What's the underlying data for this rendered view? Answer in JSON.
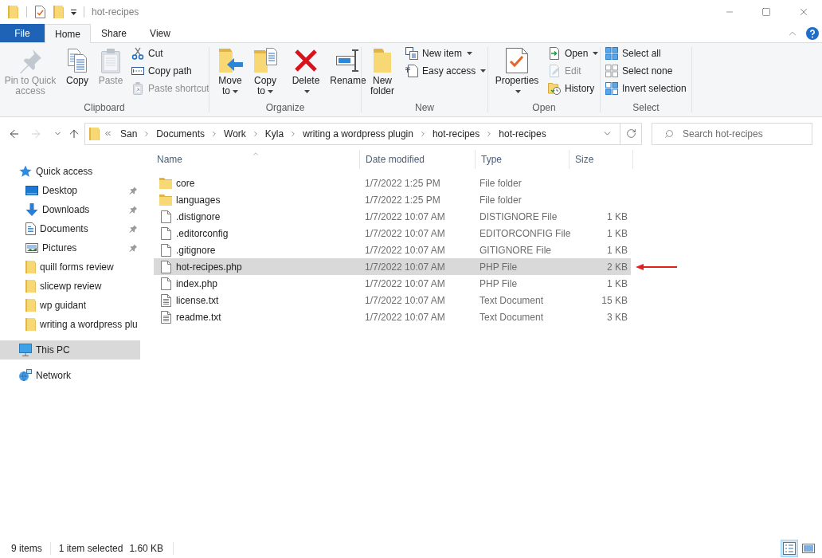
{
  "title_bar": {
    "title": "hot-recipes"
  },
  "ribbon_tabs": [
    {
      "kind": "file",
      "label": "File",
      "selected": false
    },
    {
      "kind": "tab",
      "label": "Home",
      "selected": true
    },
    {
      "kind": "tab",
      "label": "Share",
      "selected": false
    },
    {
      "kind": "tab",
      "label": "View",
      "selected": false
    }
  ],
  "ribbon_groups": [
    {
      "label": "Clipboard",
      "items": [
        {
          "kind": "large",
          "label": "Pin to Quick access",
          "disabled": true,
          "dropdown": false
        },
        {
          "kind": "large",
          "label": "Copy",
          "disabled": false,
          "dropdown": false
        },
        {
          "kind": "large",
          "label": "Paste",
          "disabled": true,
          "dropdown": false
        },
        {
          "kind": "small",
          "label": "Cut",
          "disabled": false,
          "dropdown": false
        },
        {
          "kind": "small",
          "label": "Copy path",
          "disabled": false,
          "dropdown": false
        },
        {
          "kind": "small",
          "label": "Paste shortcut",
          "disabled": true,
          "dropdown": false
        }
      ]
    },
    {
      "label": "Organize",
      "items": [
        {
          "kind": "large",
          "label": "Move to",
          "disabled": false,
          "dropdown": true
        },
        {
          "kind": "large",
          "label": "Copy to",
          "disabled": false,
          "dropdown": true
        },
        {
          "kind": "large",
          "label": "Delete",
          "disabled": false,
          "dropdown": true
        },
        {
          "kind": "large",
          "label": "Rename",
          "disabled": false,
          "dropdown": false
        }
      ]
    },
    {
      "label": "New",
      "items": [
        {
          "kind": "large",
          "label": "New folder",
          "disabled": false,
          "dropdown": false
        },
        {
          "kind": "small",
          "label": "New item",
          "disabled": false,
          "dropdown": true
        },
        {
          "kind": "small",
          "label": "Easy access",
          "disabled": false,
          "dropdown": true
        }
      ]
    },
    {
      "label": "Open",
      "items": [
        {
          "kind": "large",
          "label": "Properties",
          "disabled": false,
          "dropdown": true
        },
        {
          "kind": "small",
          "label": "Open",
          "disabled": false,
          "dropdown": true
        },
        {
          "kind": "small",
          "label": "Edit",
          "disabled": true,
          "dropdown": false
        },
        {
          "kind": "small",
          "label": "History",
          "disabled": false,
          "dropdown": false
        }
      ]
    },
    {
      "label": "Select",
      "items": [
        {
          "kind": "small",
          "label": "Select all",
          "disabled": false,
          "dropdown": false
        },
        {
          "kind": "small",
          "label": "Select none",
          "disabled": false,
          "dropdown": false
        },
        {
          "kind": "small",
          "label": "Invert selection",
          "disabled": false,
          "dropdown": false
        }
      ]
    }
  ],
  "nav_buttons": [
    {
      "kind": "back",
      "disabled": false
    },
    {
      "kind": "forward",
      "disabled": true
    },
    {
      "kind": "recent",
      "disabled": false
    },
    {
      "kind": "up",
      "disabled": false
    }
  ],
  "address_bar": {
    "path": [
      "San",
      "Documents",
      "Work",
      "Kyla",
      "writing a wordpress plugin",
      "hot-recipes",
      "hot-recipes"
    ]
  },
  "search": {
    "placeholder": "Search hot-recipes"
  },
  "navigation_pane": {
    "items": [
      {
        "kind": "quick-access",
        "label": "Quick access",
        "selected": false,
        "children": [
          {
            "kind": "desktop",
            "label": "Desktop",
            "pinned": true,
            "selected": false
          },
          {
            "kind": "downloads",
            "label": "Downloads",
            "pinned": true,
            "selected": false
          },
          {
            "kind": "documents",
            "label": "Documents",
            "pinned": true,
            "selected": false
          },
          {
            "kind": "pictures",
            "label": "Pictures",
            "pinned": true,
            "selected": false
          },
          {
            "kind": "folder",
            "label": "quill forms review",
            "pinned": false,
            "selected": false
          },
          {
            "kind": "folder",
            "label": "slicewp review",
            "pinned": false,
            "selected": false
          },
          {
            "kind": "folder",
            "label": "wp guidant",
            "pinned": false,
            "selected": false
          },
          {
            "kind": "folder",
            "label": "writing a wordpress plu",
            "pinned": false,
            "selected": false
          }
        ]
      },
      {
        "kind": "pc",
        "label": "This PC",
        "selected": true
      },
      {
        "kind": "network",
        "label": "Network",
        "selected": false
      }
    ]
  },
  "file_list": {
    "columns": [
      {
        "label": "Name",
        "sorted": true
      },
      {
        "label": "Date modified",
        "sorted": false
      },
      {
        "label": "Type",
        "sorted": false
      },
      {
        "label": "Size",
        "sorted": false
      }
    ],
    "rows": [
      {
        "kind": "folder",
        "name": "core",
        "date": "1/7/2022 1:25 PM",
        "type": "File folder",
        "selected": false,
        "marked": false
      },
      {
        "kind": "folder",
        "name": "languages",
        "date": "1/7/2022 1:25 PM",
        "type": "File folder",
        "selected": false,
        "marked": false
      },
      {
        "kind": "file",
        "name": ".distignore",
        "date": "1/7/2022 10:07 AM",
        "type": "DISTIGNORE File",
        "size": "1 KB",
        "selected": false,
        "marked": false
      },
      {
        "kind": "file",
        "name": ".editorconfig",
        "date": "1/7/2022 10:07 AM",
        "type": "EDITORCONFIG File",
        "size": "1 KB",
        "selected": false,
        "marked": false
      },
      {
        "kind": "file",
        "name": ".gitignore",
        "date": "1/7/2022 10:07 AM",
        "type": "GITIGNORE File",
        "size": "1 KB",
        "selected": false,
        "marked": false
      },
      {
        "kind": "file",
        "name": "hot-recipes.php",
        "date": "1/7/2022 10:07 AM",
        "type": "PHP File",
        "size": "2 KB",
        "selected": true,
        "marked": true
      },
      {
        "kind": "file",
        "name": "index.php",
        "date": "1/7/2022 10:07 AM",
        "type": "PHP File",
        "size": "1 KB",
        "selected": false,
        "marked": false
      },
      {
        "kind": "text",
        "name": "license.txt",
        "date": "1/7/2022 10:07 AM",
        "type": "Text Document",
        "size": "15 KB",
        "selected": false,
        "marked": false
      },
      {
        "kind": "text",
        "name": "readme.txt",
        "date": "1/7/2022 10:07 AM",
        "type": "Text Document",
        "size": "3 KB",
        "selected": false,
        "marked": false
      }
    ]
  },
  "status_bar": {
    "item_count": "9 items",
    "selection": "1 item selected",
    "selection_size": "1.60 KB",
    "views": [
      {
        "kind": "details",
        "selected": true
      },
      {
        "kind": "large-icons",
        "selected": false
      }
    ]
  }
}
